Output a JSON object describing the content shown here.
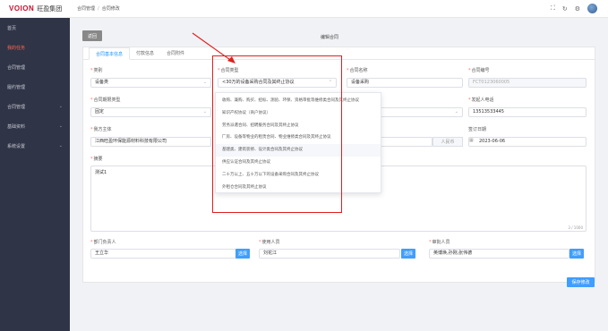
{
  "logo": {
    "mark": "VOION",
    "name": "旺盈集团"
  },
  "sidebar": {
    "items": [
      {
        "label": "首页",
        "chev": ""
      },
      {
        "label": "我的任务",
        "chev": ""
      },
      {
        "label": "合同管理",
        "chev": ""
      },
      {
        "label": "履约管理",
        "chev": ""
      },
      {
        "label": "合同管理",
        "chev": "⌄"
      },
      {
        "label": "基础资料",
        "chev": "⌄"
      },
      {
        "label": "系统设置",
        "chev": "⌄"
      }
    ]
  },
  "breadcrumb": {
    "item1": "合同管理",
    "item2": "合同修改"
  },
  "header": {
    "back": "返回",
    "title": "编辑合同"
  },
  "tabs": [
    "合同基本信息",
    "付款信息",
    "合同附件"
  ],
  "form": {
    "category": {
      "label": "类别",
      "value": "设备类"
    },
    "contract_type": {
      "label": "合同类型",
      "value": "<30万的设备采购合同及其终止协议"
    },
    "contract_name": {
      "label": "合同名称",
      "value": "设备采购"
    },
    "contract_no": {
      "label": "合同编号",
      "value": "FCT0123060005"
    },
    "period_type": {
      "label": "合同期限类型",
      "value": "固定"
    },
    "contact_phone": {
      "label": "发起人电话",
      "value": "13513533445"
    },
    "party_a": {
      "label": "我方主体",
      "value": "江西旺盈环保能源材料科技有限公司"
    },
    "party_b_addon": "人民币",
    "sign_date": {
      "label": "签订日期",
      "value": "2023-06-06"
    },
    "summary": {
      "label": "摘要",
      "value": "测试1",
      "counter": "3 / 1000"
    },
    "dept_head": {
      "label": "部门负责人",
      "value": "王立华",
      "btn": "选择"
    },
    "user": {
      "label": "使用人员",
      "value": "刘花江",
      "btn": "选择"
    },
    "reviewers": {
      "label": "审批人员",
      "value": "英博焕,孙刚,张伟德",
      "btn": "选择"
    }
  },
  "dropdown": [
    "收购、兼购、购买、招标、测验、环保、资格审批等维修类合同及其终止协议",
    "知识产权协议（商户协议）",
    "劳务派遣合同、招聘服务合同及其终止协议",
    "厂房、设备等物业的租赁合同、物业维修类合同及其终止协议",
    "基建类、建筑装修、设计类合同及其终止协议",
    "供应认证合同及其终止协议",
    "二十万以上、五十万以下的设备采购合同及其终止协议",
    "外租仓合同及其终止协议"
  ],
  "save": "保存修改"
}
